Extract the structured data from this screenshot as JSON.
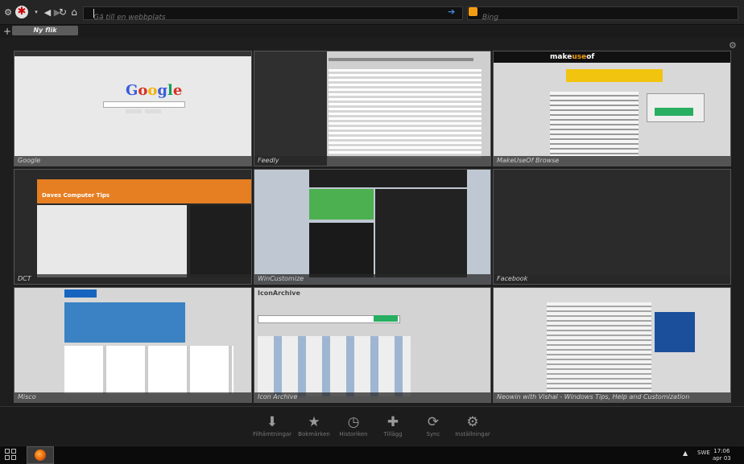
{
  "toolbar": {
    "url_placeholder": "Gå till en webbplats",
    "search_placeholder": "Bing"
  },
  "tabs": [
    {
      "label": "Ny flik"
    }
  ],
  "thumbnails": [
    {
      "label": "Google"
    },
    {
      "label": "Feedly"
    },
    {
      "label": "MakeUseOf Browse"
    },
    {
      "label": "DCT"
    },
    {
      "label": "WinCustomize"
    },
    {
      "label": "Facebook"
    },
    {
      "label": "Misco"
    },
    {
      "label": "Icon Archive"
    },
    {
      "label": "Neowin with Vishal - Windows Tips, Help and Customization"
    }
  ],
  "bottom_tools": [
    {
      "label": "Filhämtningar",
      "icon": "download-icon"
    },
    {
      "label": "Bokmärken",
      "icon": "bookmark-star-icon"
    },
    {
      "label": "Historiken",
      "icon": "history-clock-icon"
    },
    {
      "label": "Tillägg",
      "icon": "puzzle-icon"
    },
    {
      "label": "Sync",
      "icon": "sync-icon"
    },
    {
      "label": "Inställningar",
      "icon": "gear-icon"
    }
  ],
  "taskbar": {
    "language": "SWE",
    "time": "17:06",
    "date": "apr 03"
  },
  "colors": {
    "background": "#1e1e1e",
    "accent_blue": "#3b8fd8",
    "search_engine": "#f39c12"
  }
}
